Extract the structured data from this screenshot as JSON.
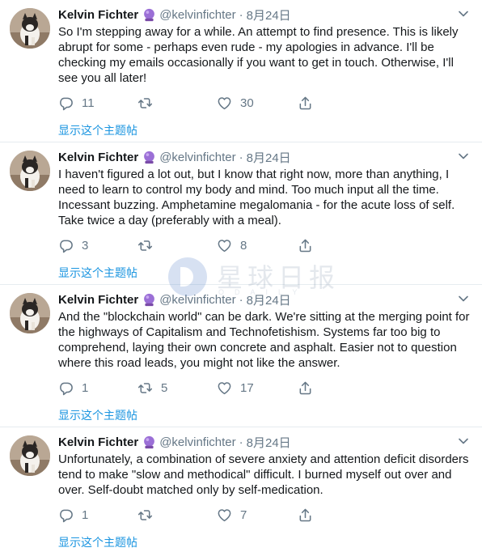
{
  "tweets": [
    {
      "name": "Kelvin Fichter",
      "handle": "@kelvinfichter",
      "separator": "·",
      "date": "8月24日",
      "text": "So I'm stepping away for a while. An attempt to find presence. This is likely abrupt for some - perhaps even rude - my apologies in advance. I'll be checking my emails occasionally if you want to get in touch. Otherwise, I'll see you all later!",
      "replies": "11",
      "retweets": "",
      "likes": "30",
      "thread_link": "显示这个主题帖"
    },
    {
      "name": "Kelvin Fichter",
      "handle": "@kelvinfichter",
      "separator": "·",
      "date": "8月24日",
      "text": "I haven't figured a lot out, but I know that right now, more than anything, I need to learn to control my body and mind. Too much input all the time. Incessant buzzing. Amphetamine megalomania - for the acute loss of self. Take twice a day (preferably with a meal).",
      "replies": "3",
      "retweets": "",
      "likes": "8",
      "thread_link": "显示这个主题帖"
    },
    {
      "name": "Kelvin Fichter",
      "handle": "@kelvinfichter",
      "separator": "·",
      "date": "8月24日",
      "text": "And the \"blockchain world\" can be dark. We're sitting at the merging point for the highways of Capitalism and Technofetishism. Systems far too big to comprehend, laying their own concrete and asphalt. Easier not to question where this road leads, you might not like the answer.",
      "replies": "1",
      "retweets": "5",
      "likes": "17",
      "thread_link": "显示这个主题帖"
    },
    {
      "name": "Kelvin Fichter",
      "handle": "@kelvinfichter",
      "separator": "·",
      "date": "8月24日",
      "text": "Unfortunately, a combination of severe anxiety and attention deficit disorders tend to make \"slow and methodical\" difficult. I burned myself out over and over. Self-doubt matched only by self-medication.",
      "replies": "1",
      "retweets": "",
      "likes": "7",
      "thread_link": "显示这个主题帖"
    }
  ],
  "watermark": {
    "text": "星球日报",
    "sub": "ODAILY"
  },
  "icons": {
    "reply": "reply-icon",
    "retweet": "retweet-icon",
    "like": "heart-icon",
    "share": "share-icon",
    "more": "chevron-down-icon",
    "emoji": "crystal-ball-icon"
  },
  "colors": {
    "link": "#1b95e0",
    "muted": "#657786",
    "text": "#14171a",
    "divider": "#e6ecf0"
  }
}
